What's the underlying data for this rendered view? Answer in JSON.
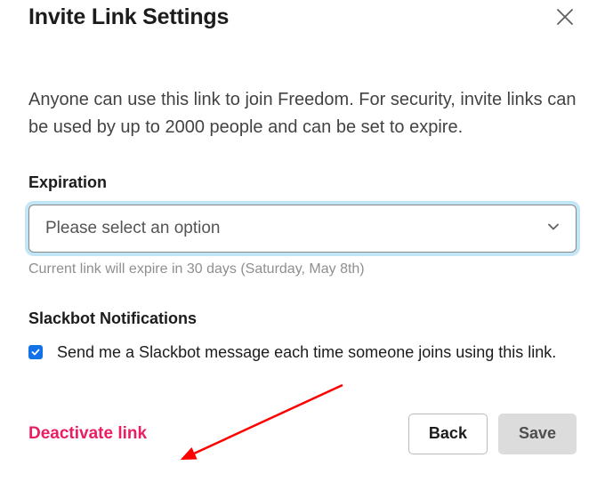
{
  "modal": {
    "title": "Invite Link Settings",
    "description": "Anyone can use this link to join Freedom. For security, invite links can be used by up to 2000 people and can be set to expire.",
    "expiration": {
      "label": "Expiration",
      "placeholder": "Please select an option",
      "helper": "Current link will expire in 30 days (Saturday, May 8th)"
    },
    "notifications": {
      "label": "Slackbot Notifications",
      "checkbox_label": "Send me a Slackbot message each time someone joins using this link.",
      "checked": true
    },
    "actions": {
      "deactivate": "Deactivate link",
      "back": "Back",
      "save": "Save"
    }
  },
  "annotation": {
    "arrow_color": "#ff0000"
  }
}
